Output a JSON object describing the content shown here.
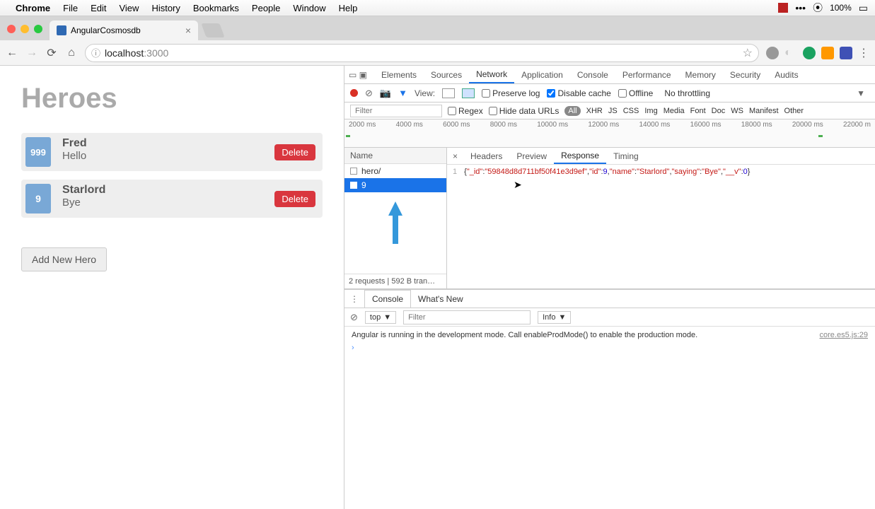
{
  "mac_menu": {
    "items": [
      "Chrome",
      "File",
      "Edit",
      "View",
      "History",
      "Bookmarks",
      "People",
      "Window",
      "Help"
    ],
    "battery": "100%"
  },
  "browser": {
    "tab_title": "AngularCosmosdb",
    "url_host": "localhost",
    "url_port": ":3000"
  },
  "page": {
    "title": "Heroes",
    "heroes": [
      {
        "id": "999",
        "name": "Fred",
        "saying": "Hello",
        "delete": "Delete"
      },
      {
        "id": "9",
        "name": "Starlord",
        "saying": "Bye",
        "delete": "Delete"
      }
    ],
    "add_button": "Add New Hero"
  },
  "devtools": {
    "tabs": [
      "Elements",
      "Sources",
      "Network",
      "Application",
      "Console",
      "Performance",
      "Memory",
      "Security",
      "Audits"
    ],
    "active_tab": "Network",
    "toolbar": {
      "view": "View:",
      "preserve": "Preserve log",
      "disable_cache": "Disable cache",
      "offline": "Offline",
      "throttling": "No throttling"
    },
    "filter": {
      "placeholder": "Filter",
      "regex": "Regex",
      "hide": "Hide data URLs",
      "types": [
        "All",
        "XHR",
        "JS",
        "CSS",
        "Img",
        "Media",
        "Font",
        "Doc",
        "WS",
        "Manifest",
        "Other"
      ]
    },
    "timeline_ticks": [
      "2000 ms",
      "4000 ms",
      "6000 ms",
      "8000 ms",
      "10000 ms",
      "12000 ms",
      "14000 ms",
      "16000 ms",
      "18000 ms",
      "20000 ms",
      "22000 m"
    ],
    "requests": {
      "header": "Name",
      "rows": [
        "hero/",
        "9"
      ],
      "selected": 1,
      "summary": "2 requests | 592 B tran…"
    },
    "detail": {
      "tabs": [
        "Headers",
        "Preview",
        "Response",
        "Timing"
      ],
      "active": "Response",
      "line_no": "1",
      "response": {
        "_id": "59848d8d711bf50f41e3d9ef",
        "id": 9,
        "name": "Starlord",
        "saying": "Bye",
        "__v": 0
      }
    },
    "console": {
      "tabs": [
        "Console",
        "What's New"
      ],
      "active": "Console",
      "context": "top",
      "filter_placeholder": "Filter",
      "level": "Info",
      "message": "Angular is running in the development mode. Call enableProdMode() to enable the production mode.",
      "source": "core.es5.js:29"
    }
  }
}
